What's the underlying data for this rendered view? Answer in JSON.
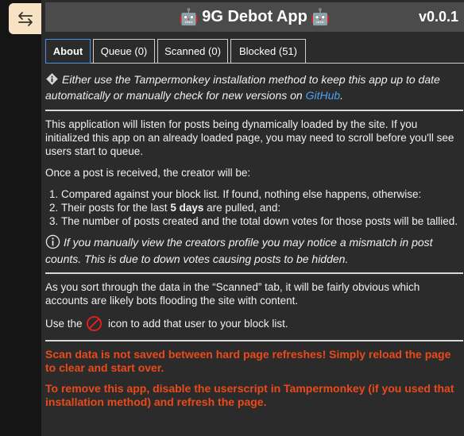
{
  "app": {
    "title": "9G Debot App",
    "version": "v0.0.1",
    "title_icon": "robot-icon",
    "toggle_icon": "swap-arrows-icon"
  },
  "tabs": [
    {
      "label": "About",
      "active": true
    },
    {
      "label": "Queue (0)",
      "active": false
    },
    {
      "label": "Scanned (0)",
      "active": false
    },
    {
      "label": "Blocked (51)",
      "active": false
    }
  ],
  "notice": {
    "text_before": "Either use the Tampermonkey installation method to keep this app up to date automatically or manually check for new versions on ",
    "link_text": "GitHub",
    "text_after": ".",
    "icon": "diamond-info-icon"
  },
  "intro": "This application will listen for posts being dynamically loaded by the site. If you initialized this app on an already loaded page, you may need to scroll before you'll see users start to queue.",
  "process": {
    "lead": "Once a post is received, the creator will be:",
    "steps": {
      "s1": "Compared against your block list. If found, nothing else happens, otherwise:",
      "s2_before": "Their posts for the last ",
      "s2_bold": "5 days",
      "s2_after": " are pulled, and:",
      "s3": "The number of posts created and the total down votes for those posts will be tallied."
    }
  },
  "mismatch_note": "If you manually view the creators profile you may notice a mismatch in post counts. This is due to down votes causing posts to be hidden.",
  "scanned_text": "As you sort through the data in the “Scanned” tab, it will be fairly obvious which accounts are likely bots flooding the site with content.",
  "block_hint": {
    "before": "Use the ",
    "after": " icon to add that user to your block list.",
    "icon": "blocked-icon",
    "icon_color": "#e02020"
  },
  "warnings": {
    "refresh": "Scan data is not saved between hard page refreshes! Simply reload the page to clear and start over.",
    "remove": "To remove this app, disable the userscript in Tampermonkey (if you used that installation method) and refresh the page."
  },
  "colors": {
    "accent_link": "#4aa3f0",
    "warning": "#ea4a1a",
    "active_tab_border": "#4a90e2",
    "toggle_bg": "#f7e3c3"
  }
}
